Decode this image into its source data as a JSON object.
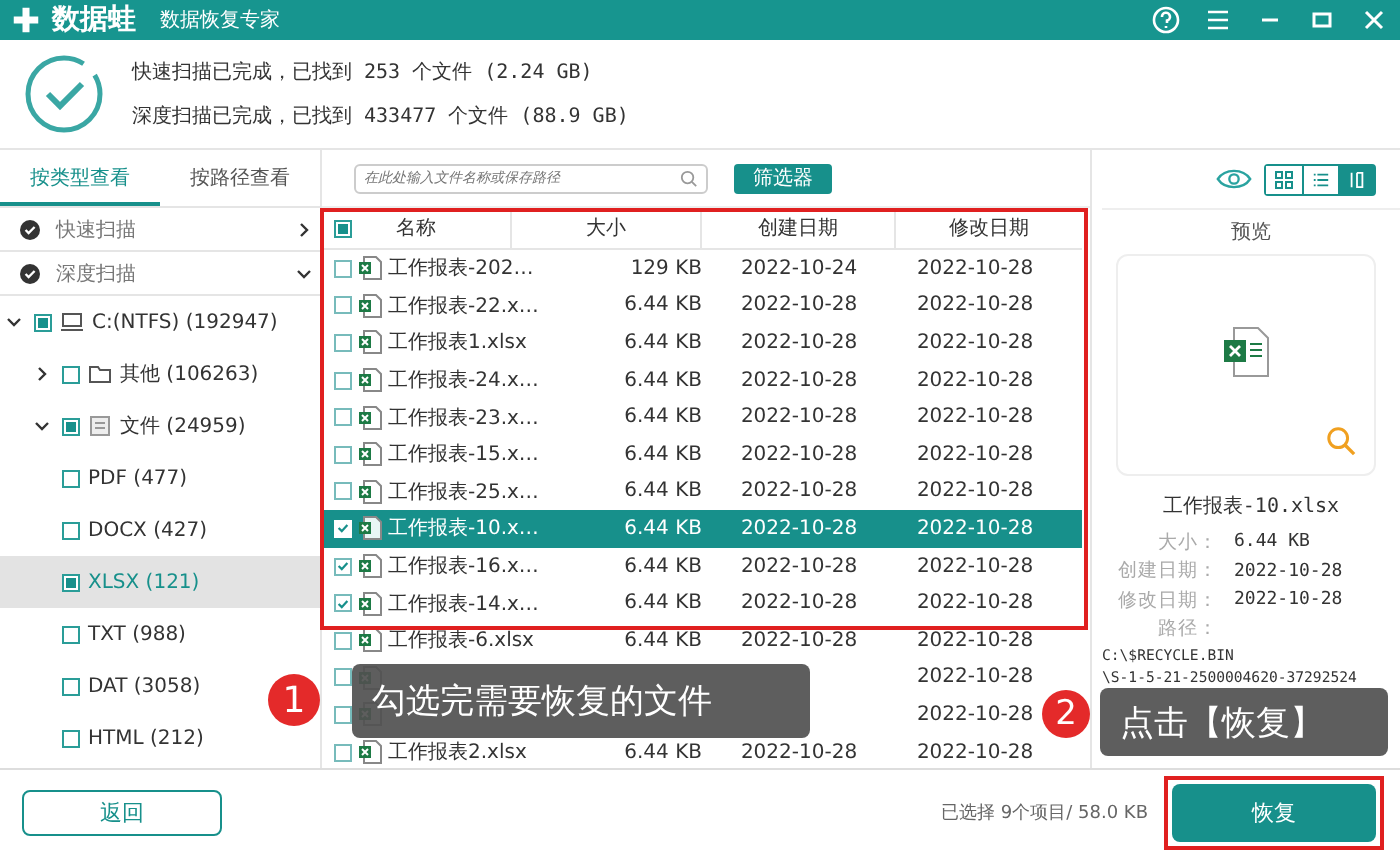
{
  "window": {
    "logo": "数据蛙",
    "subtitle": "数据恢复专家"
  },
  "scan_summary": [
    "快速扫描已完成，已找到 253 个文件 (2.24 GB)",
    "深度扫描已完成，已找到 433477 个文件 (88.9 GB)"
  ],
  "view_tabs": [
    {
      "label": "按类型查看",
      "selected": true
    },
    {
      "label": "按路径查看",
      "selected": false
    }
  ],
  "scan_groups": [
    {
      "label": "快速扫描",
      "expanded": false
    },
    {
      "label": "深度扫描",
      "expanded": true
    }
  ],
  "tree": [
    {
      "label": "C:(NTFS) (192947)",
      "kind": "drive",
      "expanded": true,
      "checked": true,
      "selected": false,
      "children": [
        {
          "label": "其他 (106263)",
          "kind": "folder",
          "expanded": false,
          "checked": false,
          "selected": false
        },
        {
          "label": "文件 (24959)",
          "kind": "files",
          "expanded": true,
          "checked": true,
          "selected": false,
          "children": [
            {
              "label": "PDF (477)",
              "checked": false,
              "selected": false
            },
            {
              "label": "DOCX (427)",
              "checked": false,
              "selected": false
            },
            {
              "label": "XLSX (121)",
              "checked": true,
              "selected": true
            },
            {
              "label": "TXT (988)",
              "checked": false,
              "selected": false
            },
            {
              "label": "DAT (3058)",
              "checked": false,
              "selected": false
            },
            {
              "label": "HTML (212)",
              "checked": false,
              "selected": false
            }
          ]
        }
      ]
    }
  ],
  "search": {
    "placeholder": "在此处输入文件名称或保存路径"
  },
  "filter_button": "筛选器",
  "view_modes": [
    {
      "kind": "grid",
      "selected": false
    },
    {
      "kind": "list",
      "selected": false
    },
    {
      "kind": "detail",
      "selected": true
    }
  ],
  "table": {
    "header_checked": true,
    "columns": [
      "名称",
      "大小",
      "创建日期",
      "修改日期"
    ],
    "rows": [
      {
        "name": "工作报表-202…",
        "size": "129 KB",
        "created": "2022-10-24",
        "modified": "2022-10-28",
        "checked": false,
        "selected": false
      },
      {
        "name": "工作报表-22.x…",
        "size": "6.44 KB",
        "created": "2022-10-28",
        "modified": "2022-10-28",
        "checked": false,
        "selected": false
      },
      {
        "name": "工作报表1.xlsx",
        "size": "6.44 KB",
        "created": "2022-10-28",
        "modified": "2022-10-28",
        "checked": false,
        "selected": false
      },
      {
        "name": "工作报表-24.x…",
        "size": "6.44 KB",
        "created": "2022-10-28",
        "modified": "2022-10-28",
        "checked": false,
        "selected": false
      },
      {
        "name": "工作报表-23.x…",
        "size": "6.44 KB",
        "created": "2022-10-28",
        "modified": "2022-10-28",
        "checked": false,
        "selected": false
      },
      {
        "name": "工作报表-15.x…",
        "size": "6.44 KB",
        "created": "2022-10-28",
        "modified": "2022-10-28",
        "checked": false,
        "selected": false
      },
      {
        "name": "工作报表-25.x…",
        "size": "6.44 KB",
        "created": "2022-10-28",
        "modified": "2022-10-28",
        "checked": false,
        "selected": false
      },
      {
        "name": "工作报表-10.x…",
        "size": "6.44 KB",
        "created": "2022-10-28",
        "modified": "2022-10-28",
        "checked": true,
        "selected": true
      },
      {
        "name": "工作报表-16.x…",
        "size": "6.44 KB",
        "created": "2022-10-28",
        "modified": "2022-10-28",
        "checked": true,
        "selected": false
      },
      {
        "name": "工作报表-14.x…",
        "size": "6.44 KB",
        "created": "2022-10-28",
        "modified": "2022-10-28",
        "checked": true,
        "selected": false
      },
      {
        "name": "工作报表-6.xlsx",
        "size": "6.44 KB",
        "created": "2022-10-28",
        "modified": "2022-10-28",
        "checked": false,
        "selected": false
      },
      {
        "modified": "2022-10-28",
        "checked": false,
        "selected": false
      },
      {
        "modified": "2022-10-28",
        "checked": false,
        "selected": false
      },
      {
        "name": "工作报表2.xlsx",
        "size": "6.44 KB",
        "created": "2022-10-28",
        "modified": "2022-10-28",
        "checked": false,
        "selected": false
      }
    ]
  },
  "preview": {
    "title": "预览",
    "file_name": "工作报表-10.xlsx",
    "details": [
      {
        "label": "大小：",
        "value": "6.44 KB"
      },
      {
        "label": "创建日期：",
        "value": "2022-10-28"
      },
      {
        "label": "修改日期：",
        "value": "2022-10-28"
      }
    ],
    "path_label": "路径：",
    "path_lines": [
      "C:\\$RECYCLE.BIN",
      "\\S-1-5-21-2500004620-37292524"
    ]
  },
  "back_button": "返回",
  "status": "已选择 9个项目/ 58.0 KB",
  "restore_button": "恢复",
  "annotations": [
    {
      "number": "1",
      "text": "勾选完需要恢复的文件"
    },
    {
      "number": "2",
      "text": "点击【恢复】"
    }
  ]
}
